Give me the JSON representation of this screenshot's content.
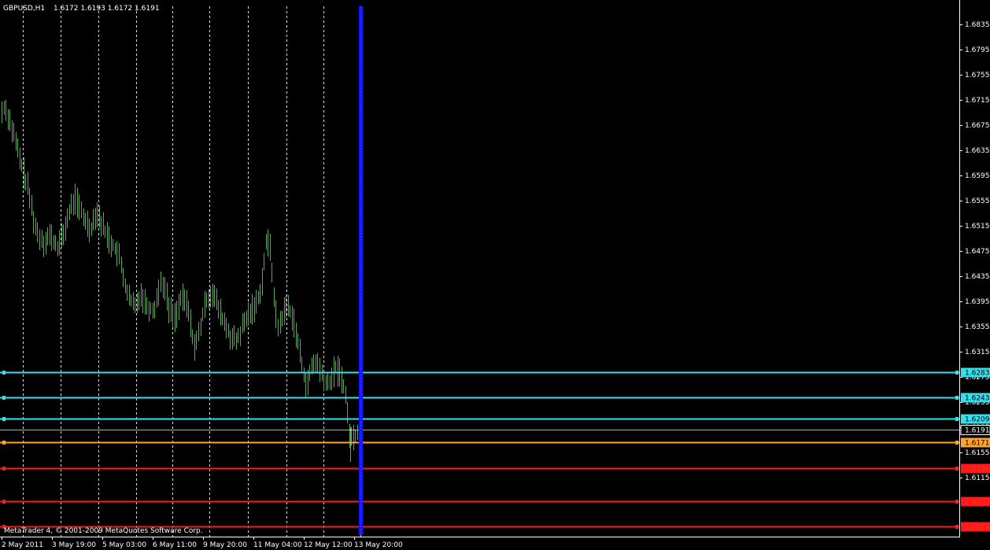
{
  "header": {
    "symbol": "GBPUSD,H1",
    "ohlc": "1.6172 1.6193 1.6172 1.6191"
  },
  "footer": {
    "copyright": "MetaTrader 4, © 2001-2009 MetaQuotes Software Corp."
  },
  "colors": {
    "background": "#000000",
    "bars": "#5aa65a",
    "grid_separator": "#ffffff",
    "resistance": "#33e0ee",
    "current_price": "#ffffff",
    "bid": "#ffa333",
    "support": "#ff1a1a",
    "period_marker": "#1414ff",
    "axis": "#ffffff"
  },
  "chart_data": {
    "type": "candlestick",
    "title": "GBPUSD,H1",
    "ylim": [
      1.6025,
      1.6855
    ],
    "y_ticks": [
      "1.6835",
      "1.6795",
      "1.6755",
      "1.6715",
      "1.6675",
      "1.6635",
      "1.6595",
      "1.6555",
      "1.6515",
      "1.6475",
      "1.6435",
      "1.6395",
      "1.6355",
      "1.6315",
      "1.6275",
      "1.6235",
      "1.6195",
      "1.6155",
      "1.6115"
    ],
    "x_tick_labels": [
      "2 May 2011",
      "3 May 19:00",
      "5 May 03:00",
      "6 May 11:00",
      "9 May 20:00",
      "11 May 04:00",
      "12 May 12:00",
      "13 May 20:00"
    ],
    "period_separators": 11,
    "bar_count": 180,
    "price_path_anchors": [
      [
        0,
        1.669
      ],
      [
        5,
        1.6705
      ],
      [
        10,
        1.669
      ],
      [
        18,
        1.6655
      ],
      [
        25,
        1.662
      ],
      [
        35,
        1.6575
      ],
      [
        46,
        1.6505
      ],
      [
        55,
        1.649
      ],
      [
        63,
        1.65
      ],
      [
        72,
        1.648
      ],
      [
        80,
        1.65
      ],
      [
        86,
        1.653
      ],
      [
        95,
        1.656
      ],
      [
        105,
        1.653
      ],
      [
        115,
        1.651
      ],
      [
        122,
        1.654
      ],
      [
        130,
        1.6515
      ],
      [
        140,
        1.649
      ],
      [
        150,
        1.647
      ],
      [
        155,
        1.644
      ],
      [
        163,
        1.64
      ],
      [
        172,
        1.6385
      ],
      [
        178,
        1.641
      ],
      [
        185,
        1.639
      ],
      [
        195,
        1.638
      ],
      [
        205,
        1.643
      ],
      [
        210,
        1.641
      ],
      [
        215,
        1.638
      ],
      [
        222,
        1.637
      ],
      [
        230,
        1.64
      ],
      [
        238,
        1.639
      ],
      [
        243,
        1.635
      ],
      [
        248,
        1.632
      ],
      [
        255,
        1.636
      ],
      [
        262,
        1.64
      ],
      [
        270,
        1.641
      ],
      [
        278,
        1.638
      ],
      [
        285,
        1.636
      ],
      [
        292,
        1.634
      ],
      [
        300,
        1.633
      ],
      [
        310,
        1.636
      ],
      [
        318,
        1.638
      ],
      [
        325,
        1.639
      ],
      [
        332,
        1.642
      ],
      [
        338,
        1.649
      ],
      [
        343,
        1.648
      ],
      [
        347,
        1.642
      ],
      [
        352,
        1.635
      ],
      [
        358,
        1.637
      ],
      [
        364,
        1.639
      ],
      [
        372,
        1.637
      ],
      [
        378,
        1.633
      ],
      [
        384,
        1.629
      ],
      [
        390,
        1.626
      ],
      [
        396,
        1.629
      ],
      [
        402,
        1.63
      ],
      [
        408,
        1.628
      ],
      [
        414,
        1.626
      ],
      [
        420,
        1.627
      ],
      [
        426,
        1.629
      ],
      [
        432,
        1.628
      ],
      [
        437,
        1.626
      ],
      [
        441,
        1.622
      ],
      [
        445,
        1.6175
      ],
      [
        450,
        1.618
      ],
      [
        455,
        1.6191
      ]
    ],
    "horizontal_levels": [
      {
        "label": "1.6283",
        "value": 1.6283,
        "kind": "resistance"
      },
      {
        "label": "1.6243",
        "value": 1.6243,
        "kind": "resistance"
      },
      {
        "label": "1.6209",
        "value": 1.6209,
        "kind": "resistance"
      },
      {
        "label": "1.6191",
        "value": 1.6191,
        "kind": "current_price"
      },
      {
        "label": "1.6171",
        "value": 1.6171,
        "kind": "bid"
      },
      {
        "label": "1.6130",
        "value": 1.613,
        "kind": "support"
      },
      {
        "label": "1.6077",
        "value": 1.6077,
        "kind": "support"
      },
      {
        "label": "1.6038",
        "value": 1.6038,
        "kind": "support"
      }
    ]
  }
}
